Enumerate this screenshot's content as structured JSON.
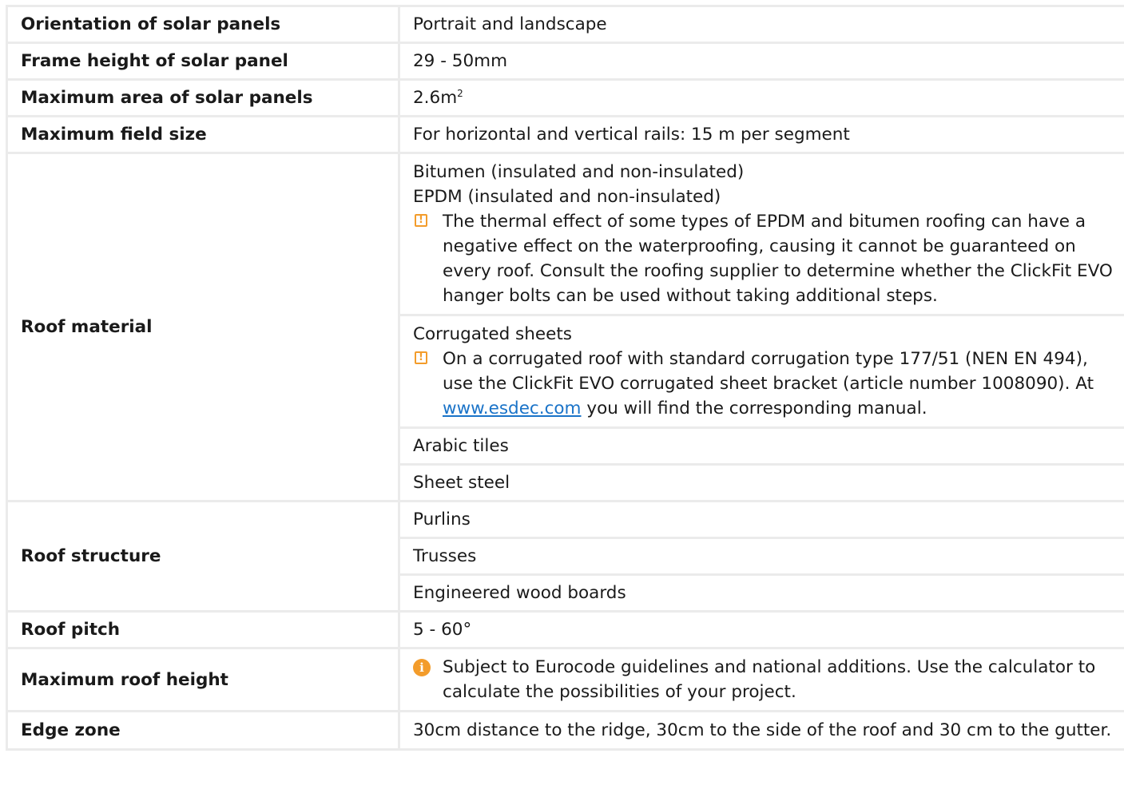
{
  "rows": {
    "orientation": {
      "label": "Orientation of solar panels",
      "value": "Portrait and landscape"
    },
    "frame_height": {
      "label": "Frame height of solar panel",
      "value": "29 - 50mm"
    },
    "max_area": {
      "label": "Maximum area of solar panels",
      "value": "2.6m",
      "unit_sup": "2"
    },
    "max_field": {
      "label": "Maximum field size",
      "value": "For horizontal and vertical rails: 15 m per segment"
    },
    "roof_material": {
      "label": "Roof material",
      "bitumen": "Bitumen (insulated and non-insulated)",
      "epdm": "EPDM (insulated and non-insulated)",
      "epdm_warning": "The thermal effect of some types of EPDM and bitumen roofing can have a negative effect on the waterproofing, causing it cannot be guaranteed on every roof. Consult the roofing supplier to determine whether the ClickFit EVO hanger bolts can be used without taking additional steps.",
      "corrugated": "Corrugated sheets",
      "corrugated_warning_a": "On a corrugated roof with standard corrugation type 177/51 (NEN EN 494), use the ClickFit EVO corrugated sheet bracket (article number 1008090). At",
      "corrugated_link": "www.esdec.com",
      "corrugated_warning_b": "you will find the corresponding manual.",
      "arabic": "Arabic tiles",
      "sheet_steel": "Sheet steel"
    },
    "roof_structure": {
      "label": "Roof structure",
      "purlins": "Purlins",
      "trusses": "Trusses",
      "boards": "Engineered wood boards"
    },
    "roof_pitch": {
      "label": "Roof pitch",
      "value": "5 - 60°"
    },
    "max_roof_height": {
      "label": "Maximum roof height",
      "value": "Subject to Eurocode guidelines and national additions. Use the calculator to calculate the possibilities of your project."
    },
    "edge_zone": {
      "label": "Edge zone",
      "value": "30cm distance to the ridge, 30cm to the side of the roof and 30 cm to the gutter."
    }
  },
  "colors": {
    "border": "#ebebeb",
    "accent": "#f39c2b",
    "link": "#1a73c8"
  },
  "icons": {
    "warning": "warning-square-icon",
    "info": "info-circle-icon"
  }
}
